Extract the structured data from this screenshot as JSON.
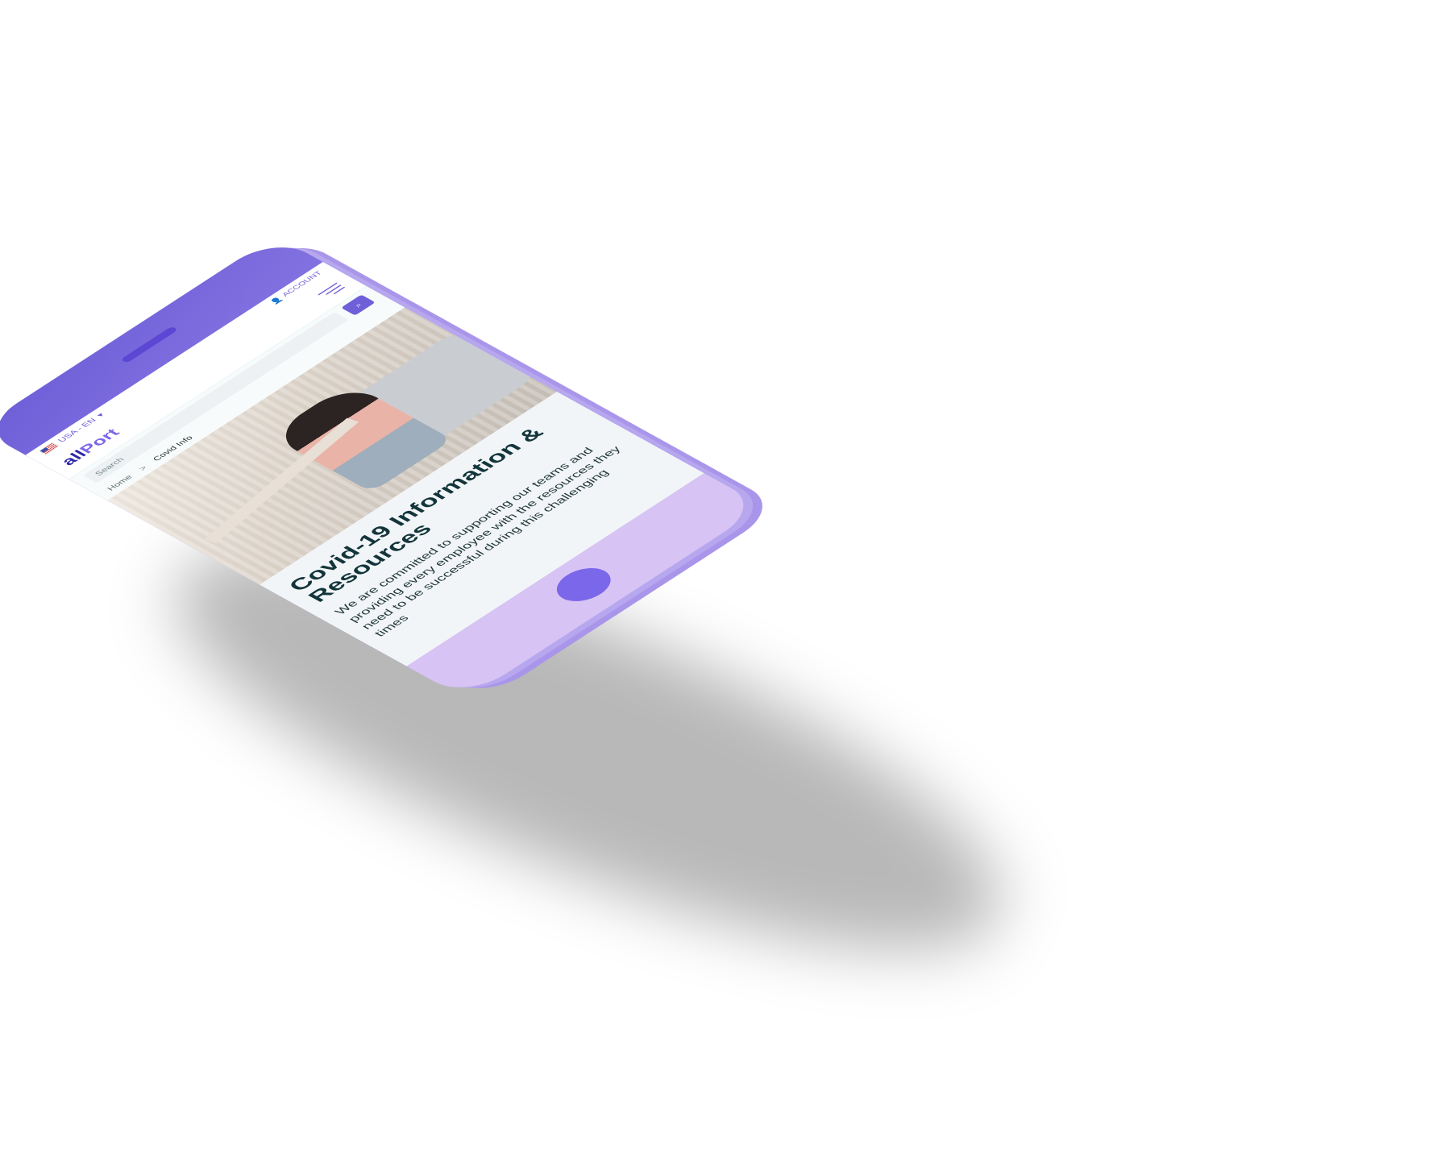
{
  "device": {
    "frame_color": "#7b67ea",
    "bottom_color": "#d7c3f4",
    "accent_color": "#6f5fd8"
  },
  "topbar": {
    "locale_label": "USA - EN",
    "flag_icon": "us-flag-icon",
    "dropdown_icon": "chevron-down-icon",
    "account_label": "ACCOUNT",
    "account_icon": "user-icon"
  },
  "nav": {
    "logo_part_1": "all",
    "logo_part_2": "Port",
    "menu_icon": "hamburger-menu-icon"
  },
  "search": {
    "placeholder": "Search",
    "search_icon": "search-icon"
  },
  "breadcrumb": {
    "home": "Home",
    "separator": ">",
    "current": "Covid Info"
  },
  "hero": {
    "image_icon": "woman-with-mask-tablet-image"
  },
  "content": {
    "title": "Covid-19 Information & Resources",
    "body": "We are committed to supporting our teams and providing every employee with the resources they need to be successful during this challenging times"
  }
}
